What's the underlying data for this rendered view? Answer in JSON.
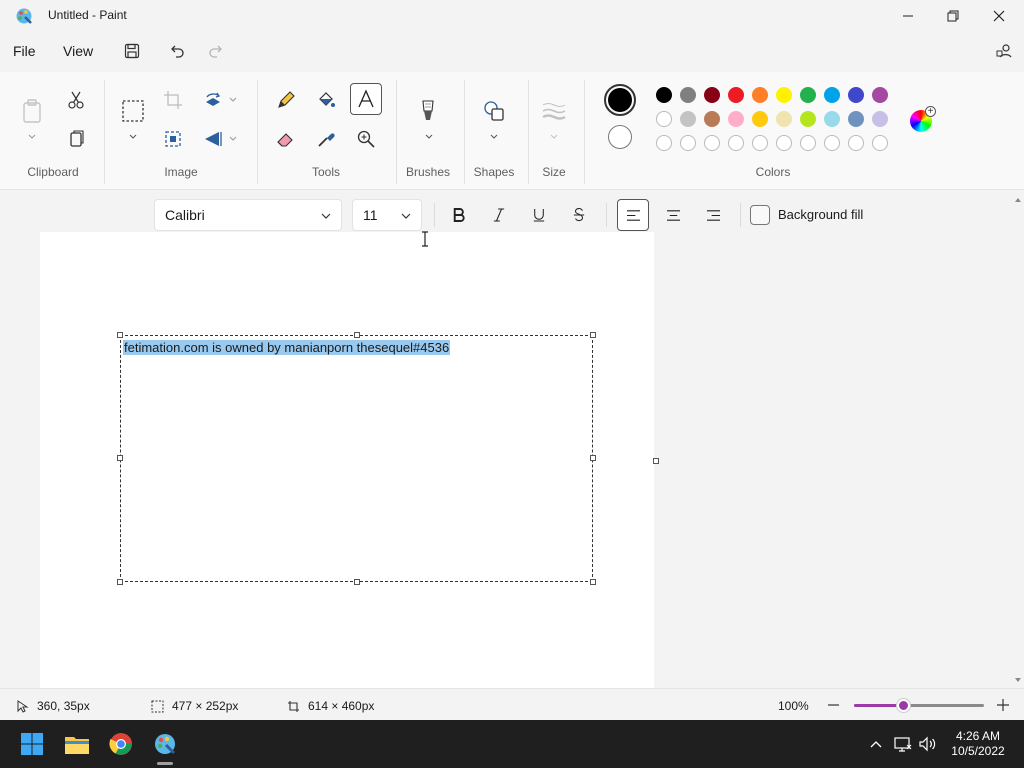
{
  "window": {
    "title": "Untitled - Paint"
  },
  "menu": {
    "file": "File",
    "view": "View"
  },
  "ribbon": {
    "groups": {
      "clipboard": "Clipboard",
      "image": "Image",
      "tools": "Tools",
      "brushes": "Brushes",
      "shapes": "Shapes",
      "size": "Size",
      "colors": "Colors"
    },
    "palette_row1": [
      "#000000",
      "#7f7f7f",
      "#880015",
      "#ed1c24",
      "#ff7f27",
      "#fff200",
      "#22b14c",
      "#00a2e8",
      "#3f48cc",
      "#a349a4"
    ],
    "palette_row2": [
      "#ffffff",
      "#c3c3c3",
      "#b97a57",
      "#ffaec9",
      "#ffc90e",
      "#efe4b0",
      "#b5e61d",
      "#99d9ea",
      "#7092be",
      "#c8bfe7"
    ],
    "primary_color": "#000000",
    "secondary_color": "#ffffff"
  },
  "format": {
    "font": "Calibri",
    "size": "11",
    "background_fill": "Background fill"
  },
  "canvas": {
    "text": "fetimation.com is owned by manianporn thesequel#4536"
  },
  "status": {
    "cursor_position": "360, 35px",
    "selection_size": "477 × 252px",
    "canvas_size": "614 × 460px",
    "zoom": "100%",
    "zoom_fraction": 0.38
  },
  "taskbar": {
    "time": "4:26 AM",
    "date": "10/5/2022"
  }
}
